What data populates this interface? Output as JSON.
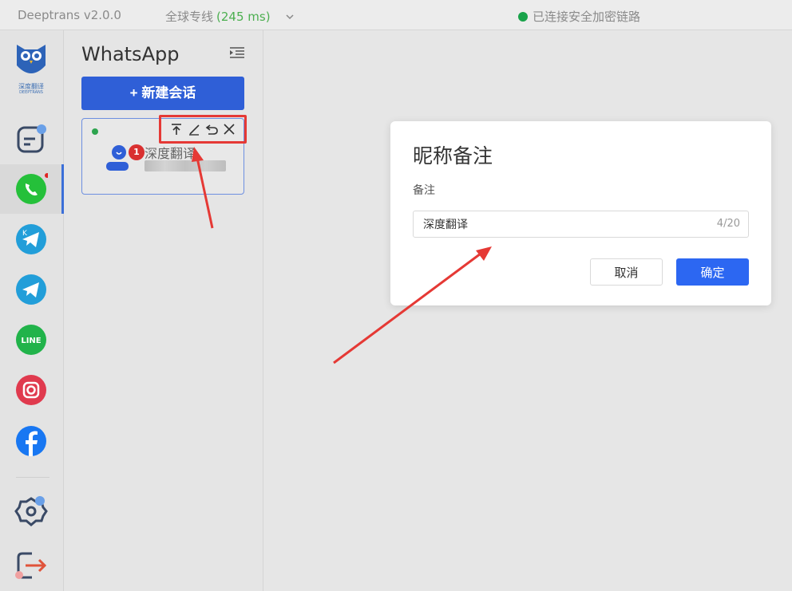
{
  "topbar": {
    "app_title": "Deeptrans v2.0.0",
    "line_label": "全球专线",
    "latency": "(245 ms)",
    "connection_status": "已连接安全加密链路"
  },
  "logo": {
    "name_cn": "深度翻译",
    "name_en": "DEEPTRANS"
  },
  "rail": {
    "items": [
      "deeptrans-chat",
      "whatsapp",
      "telegram-k",
      "telegram",
      "line",
      "instagram",
      "facebook",
      "settings",
      "logout"
    ],
    "active": "whatsapp",
    "line_text": "LINE"
  },
  "panel": {
    "title": "WhatsApp",
    "new_session_label": "+ 新建会话",
    "session": {
      "name": "深度翻译",
      "unread": "1",
      "online": true
    }
  },
  "dialog": {
    "title": "昵称备注",
    "field_label": "备注",
    "input_value": "深度翻译",
    "char_count": "4/20",
    "cancel_label": "取消",
    "confirm_label": "确定"
  },
  "colors": {
    "primary": "#2f5fd7",
    "confirm": "#2c67f2",
    "annotation": "#e53935",
    "whatsapp": "#25c03a",
    "telegram": "#229ed9",
    "line": "#21b34a",
    "instagram": "#e03a4e",
    "facebook": "#1877f2"
  }
}
